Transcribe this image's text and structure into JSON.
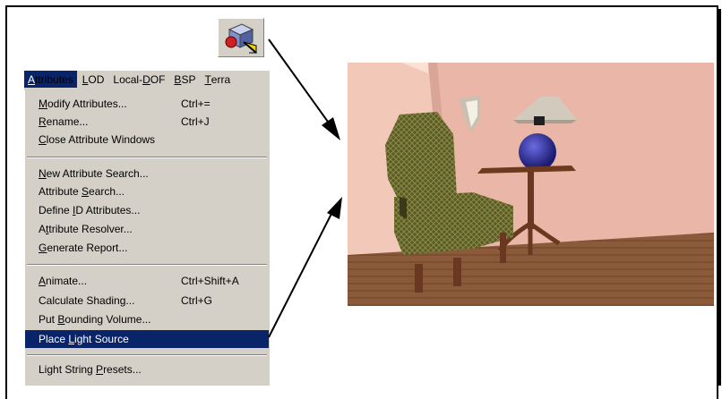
{
  "menubar": {
    "items": [
      {
        "pre": "",
        "u": "A",
        "post": "ttributes",
        "active": true
      },
      {
        "pre": "",
        "u": "L",
        "post": "OD",
        "active": false
      },
      {
        "pre": "Local-",
        "u": "D",
        "post": "OF",
        "active": false
      },
      {
        "pre": "",
        "u": "B",
        "post": "SP",
        "active": false
      },
      {
        "pre": "",
        "u": "T",
        "post": "erra",
        "active": false
      }
    ]
  },
  "menu": {
    "items": [
      {
        "pre": "",
        "u": "M",
        "post": "odify Attributes...",
        "shortcut": "Ctrl+="
      },
      {
        "pre": "",
        "u": "R",
        "post": "ename...",
        "shortcut": "Ctrl+J"
      },
      {
        "pre": "",
        "u": "C",
        "post": "lose Attribute Windows",
        "shortcut": ""
      },
      {
        "pre": "",
        "u": "N",
        "post": "ew Attribute Search...",
        "shortcut": ""
      },
      {
        "pre": "Attribute ",
        "u": "S",
        "post": "earch...",
        "shortcut": ""
      },
      {
        "pre": "Define ",
        "u": "I",
        "post": "D Attributes...",
        "shortcut": ""
      },
      {
        "pre": "A",
        "u": "t",
        "post": "tribute Resolver...",
        "shortcut": ""
      },
      {
        "pre": "",
        "u": "G",
        "post": "enerate Report...",
        "shortcut": ""
      },
      {
        "pre": "",
        "u": "A",
        "post": "nimate...",
        "shortcut": "Ctrl+Shift+A"
      },
      {
        "pre": "Calculate Shading...",
        "u": "",
        "post": "",
        "shortcut": "Ctrl+G"
      },
      {
        "pre": "Put ",
        "u": "B",
        "post": "ounding Volume...",
        "shortcut": ""
      },
      {
        "pre": "Place ",
        "u": "L",
        "post": "ight Source",
        "shortcut": ""
      },
      {
        "pre": "Light String ",
        "u": "P",
        "post": "resets...",
        "shortcut": ""
      }
    ]
  },
  "icons": {
    "toolbar": "place-light-source-icon"
  },
  "colors": {
    "highlight": "#0a246a",
    "menu_bg": "#d4d0c8"
  }
}
